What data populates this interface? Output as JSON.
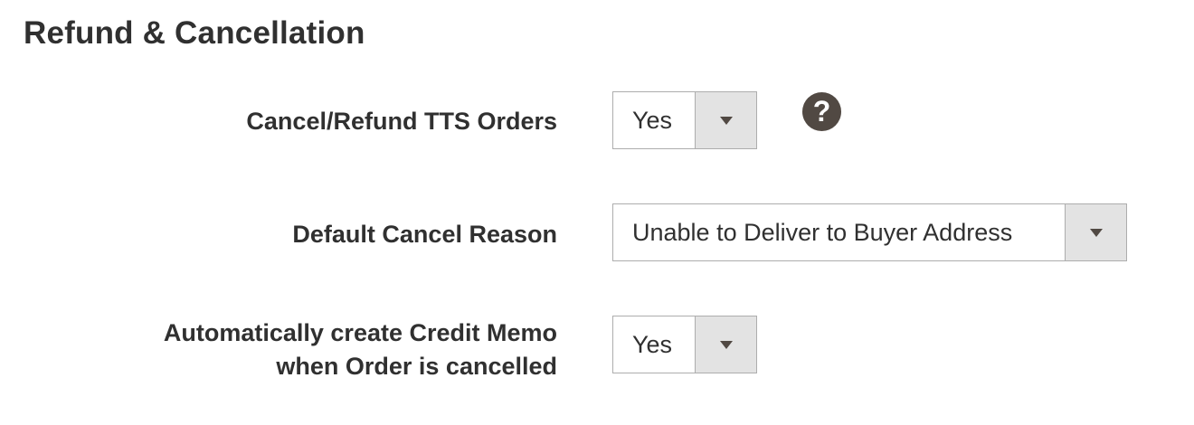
{
  "section": {
    "title": "Refund & Cancellation"
  },
  "fields": {
    "cancel_refund": {
      "label": "Cancel/Refund TTS Orders",
      "value": "Yes",
      "help_glyph": "?"
    },
    "cancel_reason": {
      "label": "Default Cancel Reason",
      "value": "Unable to Deliver to Buyer Address"
    },
    "credit_memo": {
      "label_line1": "Automatically create Credit Memo",
      "label_line2": "when Order is cancelled",
      "value": "Yes"
    }
  },
  "icons": {
    "dropdown": "triangle-down-icon",
    "help": "question-circle-icon"
  },
  "colors": {
    "text": "#303030",
    "border": "#adadad",
    "arrow_bg": "#e3e3e3",
    "icon": "#514943"
  }
}
